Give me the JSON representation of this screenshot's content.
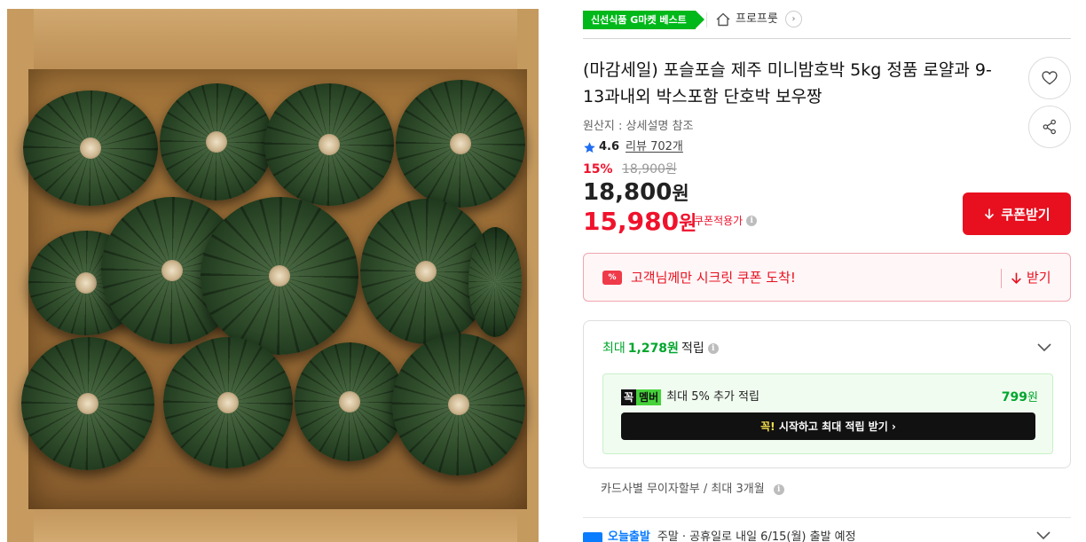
{
  "badge": "신선식품 G마켓 베스트",
  "brand": {
    "name": "프로프룻",
    "arrow": "›",
    "icon": "home-icon"
  },
  "title": "(마감세일) 포슬포슬 제주 미니밤호박 5kg 정품 로얄과 9-13과내외 박스포함 단호박 보우짱",
  "origin": "원산지 : 상세설명 참조",
  "rating": {
    "score": "4.6",
    "review": "리뷰 702개",
    "icon": "star-icon"
  },
  "price": {
    "discount_rate": "15%",
    "original": "18,900원",
    "sale_amount": "18,800",
    "sale_unit": "원",
    "coupon_amount": "15,980",
    "coupon_unit": "원",
    "coupon_label": "쿠폰적용가",
    "info_mark": "i"
  },
  "buttons": {
    "coupon": "쿠폰받기"
  },
  "secret_coupon": {
    "ticket": "%",
    "message": "고객님께만 시크릿 쿠폰 도착!",
    "action": "받기"
  },
  "mileage": {
    "prefix": "최대",
    "amount": "1,278원",
    "suffix": "적립",
    "member_tag_1": "꼭",
    "member_tag_2": "멤버",
    "member_text": "최대 5% 추가 적립",
    "member_amount": "799",
    "member_unit": "원",
    "cta_highlight": "꼭!",
    "cta_text": "시작하고 최대 적립 받기 ›"
  },
  "card_info": "카드사별 무이자할부 / 최대 3개월",
  "delivery": {
    "label": "오늘출발",
    "text": "주말 · 공휴일로 내일 6/15(월) 출발 예정"
  },
  "colors": {
    "accent_red": "#e8101f",
    "green": "#00a62c",
    "badge_green": "#00b81a"
  }
}
